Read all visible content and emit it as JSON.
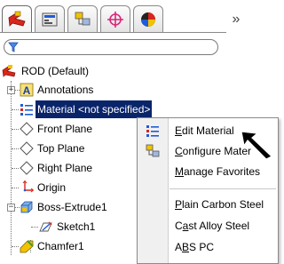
{
  "tabs": [
    {
      "icon": "feature-manager-icon"
    },
    {
      "icon": "property-manager-icon"
    },
    {
      "icon": "configuration-manager-icon"
    },
    {
      "icon": "dimxpert-icon"
    },
    {
      "icon": "display-manager-icon"
    }
  ],
  "tabs_more_label": "»",
  "filter": {
    "icon": "filter-icon"
  },
  "tree": {
    "root": "ROD  (Default)",
    "items": [
      {
        "label": "Annotations"
      },
      {
        "label": "Material <not specified>"
      },
      {
        "label": "Front Plane"
      },
      {
        "label": "Top Plane"
      },
      {
        "label": "Right Plane"
      },
      {
        "label": "Origin"
      },
      {
        "label": "Boss-Extrude1"
      },
      {
        "label": "Sketch1"
      },
      {
        "label": "Chamfer1"
      }
    ]
  },
  "context_menu": {
    "items": [
      {
        "pre": "",
        "u": "E",
        "post": "dit Material"
      },
      {
        "pre": "",
        "u": "C",
        "post": "onfigure Mater"
      },
      {
        "pre": "",
        "u": "M",
        "post": "anage Favorites"
      },
      {
        "pre": "",
        "u": "P",
        "post": "lain Carbon Steel"
      },
      {
        "pre": "C",
        "u": "a",
        "post": "st Alloy Steel"
      },
      {
        "pre": "A",
        "u": "B",
        "post": "S PC"
      }
    ]
  },
  "colors": {
    "selection": "#0a246a",
    "accent_red": "#d9261c",
    "accent_blue": "#1e5bd8"
  }
}
